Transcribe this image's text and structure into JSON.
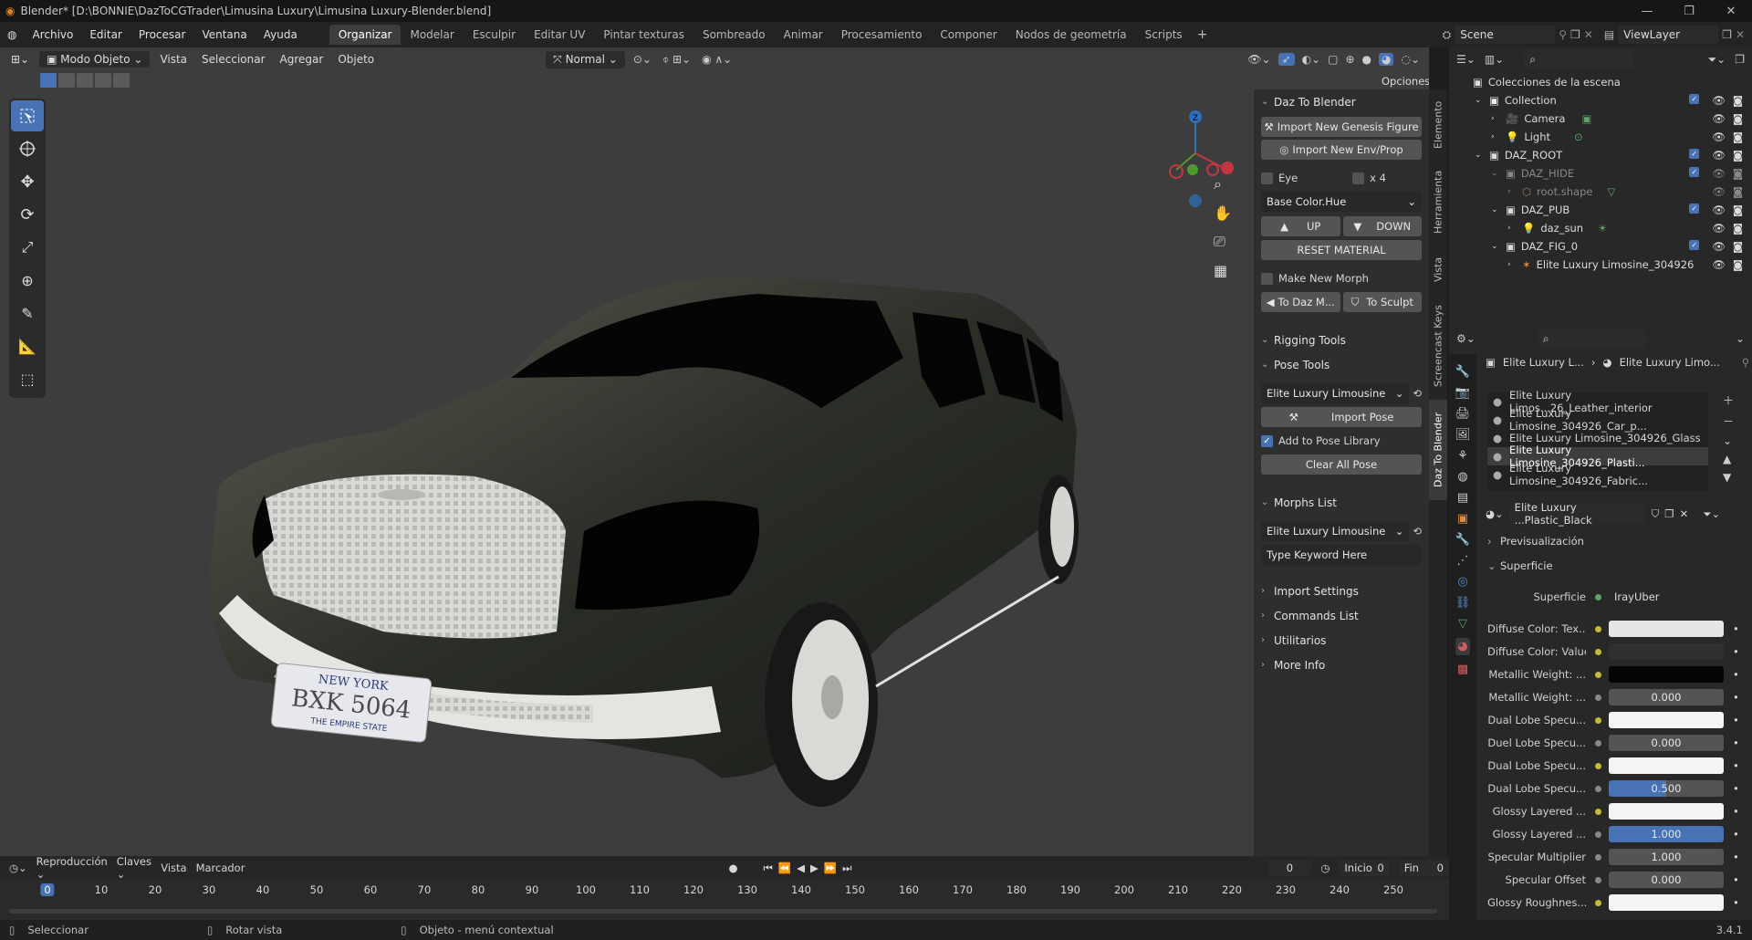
{
  "titlebar": {
    "title": "Blender* [D:\\BONNIE\\DazToCGTrader\\Limusina Luxury\\Limusina Luxury-Blender.blend]"
  },
  "menu": [
    "Archivo",
    "Editar",
    "Procesar",
    "Ventana",
    "Ayuda"
  ],
  "workspaces": [
    "Organizar",
    "Modelar",
    "Esculpir",
    "Editar UV",
    "Pintar texturas",
    "Sombreado",
    "Animar",
    "Procesamiento",
    "Componer",
    "Nodos de geometría",
    "Scripts"
  ],
  "scene": "Scene",
  "view_layer": "ViewLayer",
  "viewport_header": {
    "mode": "Modo Objeto",
    "vista": "Vista",
    "seleccionar": "Seleccionar",
    "agregar": "Agregar",
    "objeto": "Objeto",
    "orientation": "Normal",
    "opciones": "Opciones"
  },
  "vtabs": [
    "Elemento",
    "Herramienta",
    "Vista",
    "Screencast Keys",
    "Daz To Blender"
  ],
  "npanel": {
    "daz_header": "Daz To Blender",
    "import_genesis": "Import New Genesis Figure",
    "import_env": "Import New Env/Prop",
    "eye": "Eye",
    "x4": "x 4",
    "base_color": "Base Color.Hue",
    "up": "UP",
    "down": "DOWN",
    "reset_material": "RESET MATERIAL",
    "make_new_morph": "Make New Morph",
    "to_daz": "To Daz M...",
    "to_sculpt": "To Sculpt",
    "rigging_tools": "Rigging Tools",
    "pose_tools": "Pose Tools",
    "pose_select": "Elite Luxury Limousine",
    "import_pose": "Import Pose",
    "add_pose_library": "Add to Pose Library",
    "clear_all_pose": "Clear All Pose",
    "morphs_list": "Morphs List",
    "morph_select": "Elite Luxury Limousine",
    "keyword_placeholder": "Type Keyword Here",
    "import_settings": "Import Settings",
    "commands_list": "Commands List",
    "utilitarios": "Utilitarios",
    "more_info": "More Info"
  },
  "outliner": {
    "root": "Colecciones de la escena",
    "rows": [
      {
        "label": "Collection"
      },
      {
        "label": "Camera"
      },
      {
        "label": "Light"
      },
      {
        "label": "DAZ_ROOT"
      },
      {
        "label": "DAZ_HIDE"
      },
      {
        "label": "root.shape"
      },
      {
        "label": "DAZ_PUB"
      },
      {
        "label": "daz_sun"
      },
      {
        "label": "DAZ_FIG_0"
      },
      {
        "label": "Elite Luxury Limosine_304926"
      }
    ]
  },
  "properties": {
    "breadcrumb_obj": "Elite Luxury L...",
    "breadcrumb_mat": "Elite Luxury Limo...",
    "materials": [
      "Elite Luxury Limos...26_Leather_interior",
      "Elite Luxury Limosine_304926_Car_p...",
      "Elite Luxury Limosine_304926_Glass",
      "Elite Luxury Limosine_304926_Plasti...",
      "Elite Luxury Limosine_304926_Fabric..."
    ],
    "material_name": "Elite Luxury ...Plastic_Black",
    "previsualizacion": "Previsualización",
    "superficie": "Superficie",
    "surface_label": "Superficie",
    "surface_value": "IrayUber",
    "rows": [
      {
        "label": "Diffuse Color: Tex...",
        "value": ""
      },
      {
        "label": "Diffuse Color: Value",
        "value": ""
      },
      {
        "label": "Metallic Weight: ...",
        "value": ""
      },
      {
        "label": "Metallic Weight: ...",
        "value": "0.000"
      },
      {
        "label": "Dual Lobe Specu...",
        "value": ""
      },
      {
        "label": "Duel Lobe Specu...",
        "value": "0.000"
      },
      {
        "label": "Dual Lobe Specu...",
        "value": ""
      },
      {
        "label": "Dual Lobe Specu...",
        "value": "0.500"
      },
      {
        "label": "Glossy Layered ...",
        "value": ""
      },
      {
        "label": "Glossy Layered ...",
        "value": "1.000"
      },
      {
        "label": "Specular Multiplier",
        "value": "1.000"
      },
      {
        "label": "Specular Offset",
        "value": "0.000"
      },
      {
        "label": "Glossy Roughnes...",
        "value": ""
      }
    ]
  },
  "timeline": {
    "reproduccion": "Reproducción",
    "claves": "Claves",
    "vista": "Vista",
    "marcador": "Marcador",
    "current_frame": "0",
    "inicio_label": "Inicio",
    "inicio": "0",
    "fin_label": "Fin",
    "fin": "0",
    "ticks": [
      "0",
      "10",
      "20",
      "30",
      "40",
      "50",
      "60",
      "70",
      "80",
      "90",
      "100",
      "110",
      "120",
      "130",
      "140",
      "150",
      "160",
      "170",
      "180",
      "190",
      "200",
      "210",
      "220",
      "230",
      "240",
      "250"
    ]
  },
  "statusbar": {
    "select": "Seleccionar",
    "rotate": "Rotar vista",
    "context": "Objeto - menú contextual",
    "version": "3.4.1"
  },
  "plate": {
    "top": "NEW YORK",
    "number": "BXK 5064",
    "bottom": "THE EMPIRE STATE"
  }
}
